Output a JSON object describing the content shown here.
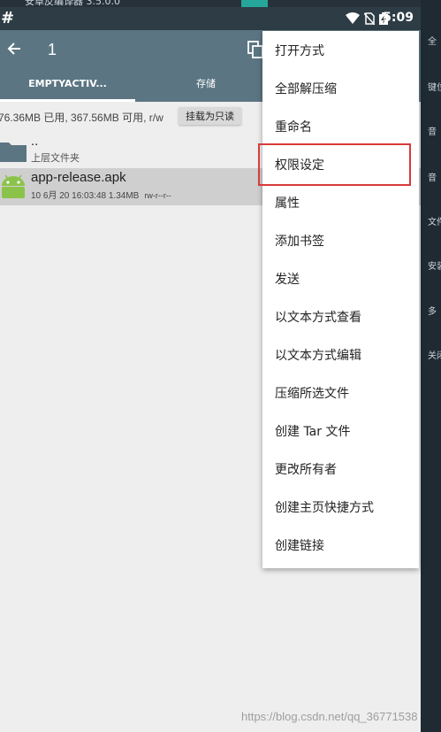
{
  "desktop_top": {
    "text": "安卓反编译器 3.5.0.0"
  },
  "status_bar": {
    "left_glyph": "#",
    "time": "5:09"
  },
  "app_bar": {
    "title": "1"
  },
  "tabs": [
    {
      "label": "EMPTYACTIV..."
    },
    {
      "label": "存储"
    }
  ],
  "info_bar": {
    "storage": "76.36MB 已用, 367.56MB 可用, r/w",
    "mount_button": "挂载为只读"
  },
  "files": [
    {
      "name": "..",
      "sub": "上层文件夹"
    },
    {
      "name": "app-release.apk",
      "date": "10 6月 20 16:03:48",
      "size": "1.34MB",
      "perm": "rw-r--r--"
    }
  ],
  "menu": {
    "items": [
      "打开方式",
      "全部解压缩",
      "重命名",
      "权限设定",
      "属性",
      "添加书签",
      "发送",
      "以文本方式查看",
      "以文本方式编辑",
      "压缩所选文件",
      "创建 Tar 文件",
      "更改所有者",
      "创建主页快捷方式",
      "创建链接"
    ],
    "highlighted_index": 3
  },
  "right_strip": {
    "items": [
      "全",
      "键位",
      "音",
      "音",
      "文件",
      "安装",
      "多",
      "关闭"
    ]
  },
  "watermark": "https://blog.csdn.net/qq_36771538",
  "colors": {
    "app_bar": "#5b7583",
    "status_bar": "#2e3d45",
    "highlight_box": "#d83b3b",
    "android_green": "#8bc34a",
    "folder": "#5b7583"
  }
}
